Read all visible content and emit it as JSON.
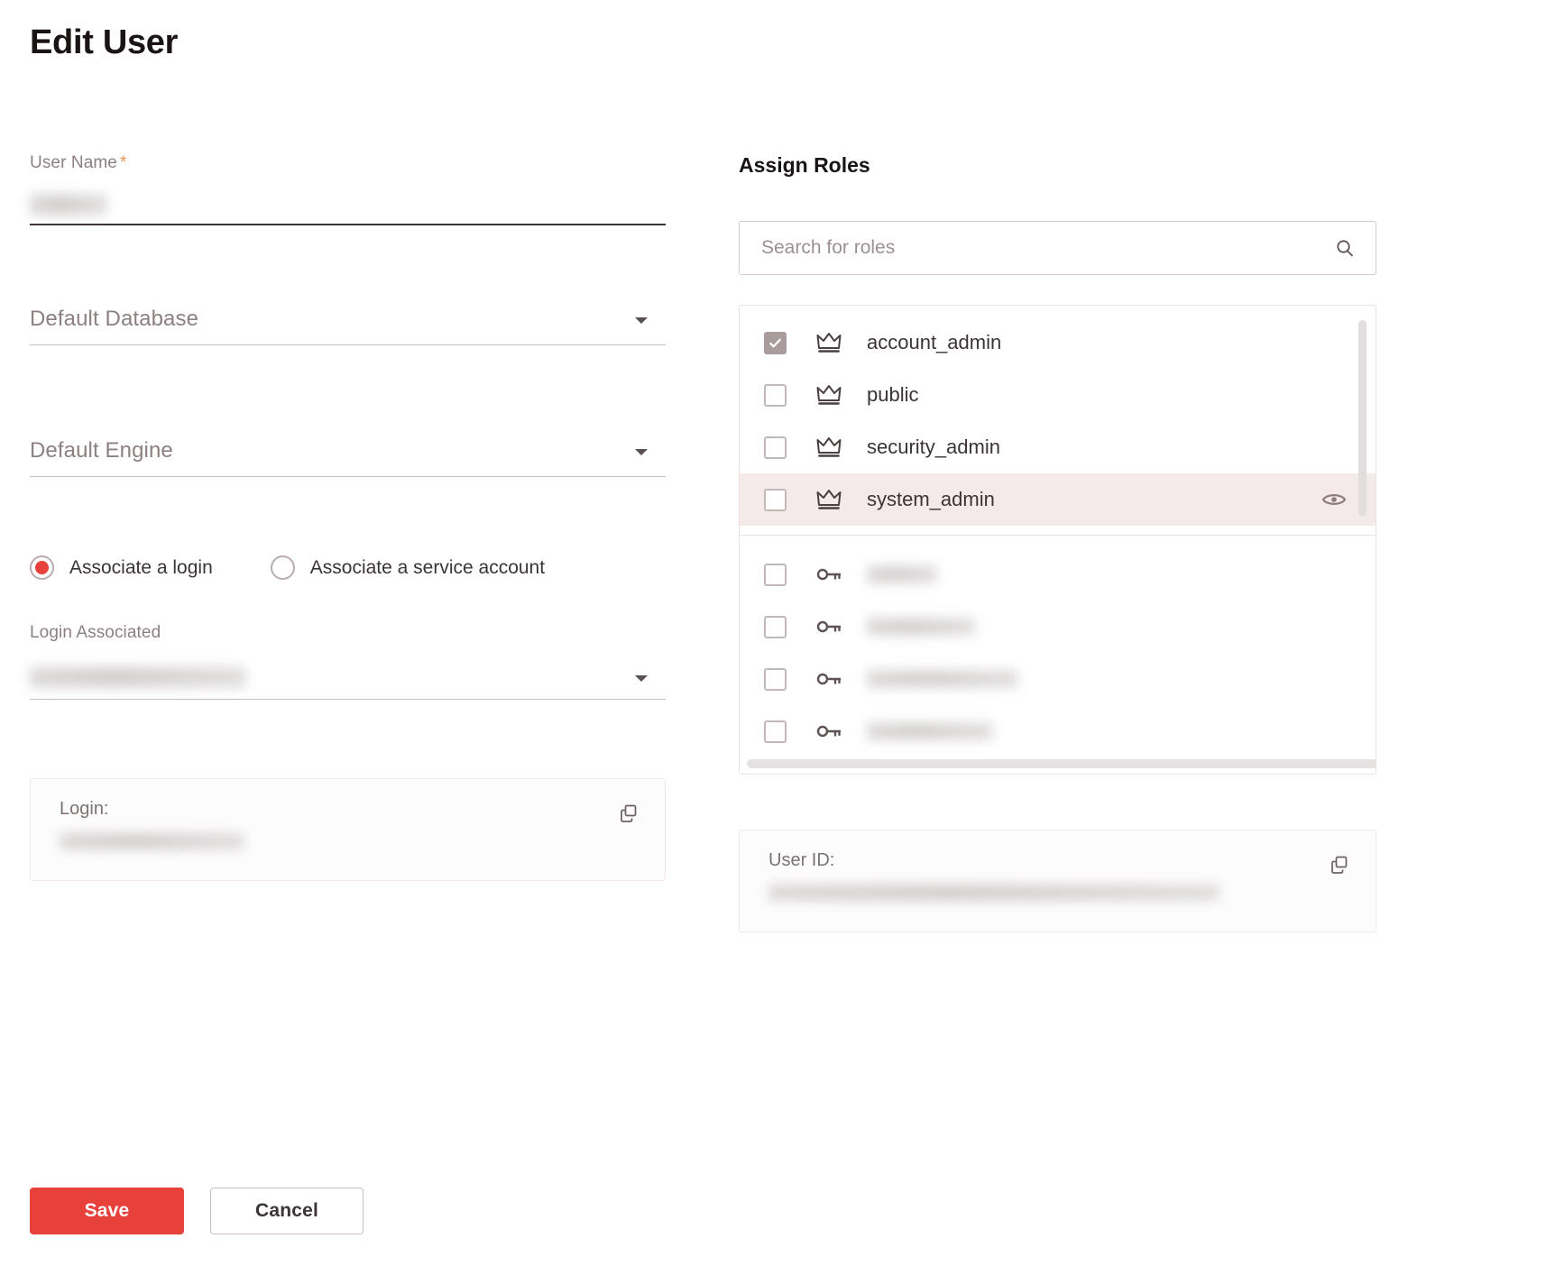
{
  "page": {
    "title": "Edit User"
  },
  "form": {
    "user_name": {
      "label": "User Name",
      "required_marker": "*",
      "value_redacted": true
    },
    "default_database": {
      "placeholder": "Default Database",
      "value": "",
      "caret_icon": "chevron-down-icon"
    },
    "default_engine": {
      "placeholder": "Default Engine",
      "value": "",
      "caret_icon": "chevron-down-icon"
    },
    "association": {
      "options": [
        {
          "label": "Associate a login",
          "selected": true
        },
        {
          "label": "Associate a service account",
          "selected": false
        }
      ]
    },
    "login_associated": {
      "label": "Login Associated",
      "value_redacted": true,
      "caret_icon": "chevron-down-icon"
    }
  },
  "roles_panel": {
    "heading": "Assign Roles",
    "search": {
      "placeholder": "Search for roles",
      "value": "",
      "icon": "search-icon"
    },
    "named_roles": [
      {
        "name": "account_admin",
        "icon": "crown-icon",
        "checked": true,
        "hovered": false
      },
      {
        "name": "public",
        "icon": "crown-icon",
        "checked": false,
        "hovered": false
      },
      {
        "name": "security_admin",
        "icon": "crown-icon",
        "checked": false,
        "hovered": false
      },
      {
        "name": "system_admin",
        "icon": "crown-icon",
        "checked": false,
        "hovered": true,
        "action_icon": "eye-icon"
      }
    ],
    "redacted_roles": [
      {
        "icon": "key-icon",
        "checked": false,
        "redacted": true
      },
      {
        "icon": "key-icon",
        "checked": false,
        "redacted": true
      },
      {
        "icon": "key-icon",
        "checked": false,
        "redacted": true
      },
      {
        "icon": "key-icon",
        "checked": false,
        "redacted": true
      }
    ]
  },
  "info_cards": {
    "login": {
      "label": "Login:",
      "value_redacted": true,
      "copy_icon": "copy-icon"
    },
    "user_id": {
      "label": "User ID:",
      "value_redacted": true,
      "copy_icon": "copy-icon"
    }
  },
  "actions": {
    "save_label": "Save",
    "cancel_label": "Cancel"
  },
  "colors": {
    "accent_red": "#E8413C",
    "required_star": "#E8954F",
    "row_highlight": "#F4EAEA",
    "checkbox_checked": "#A99C9C",
    "text_primary": "#3C3434",
    "text_muted": "#8C8080"
  }
}
